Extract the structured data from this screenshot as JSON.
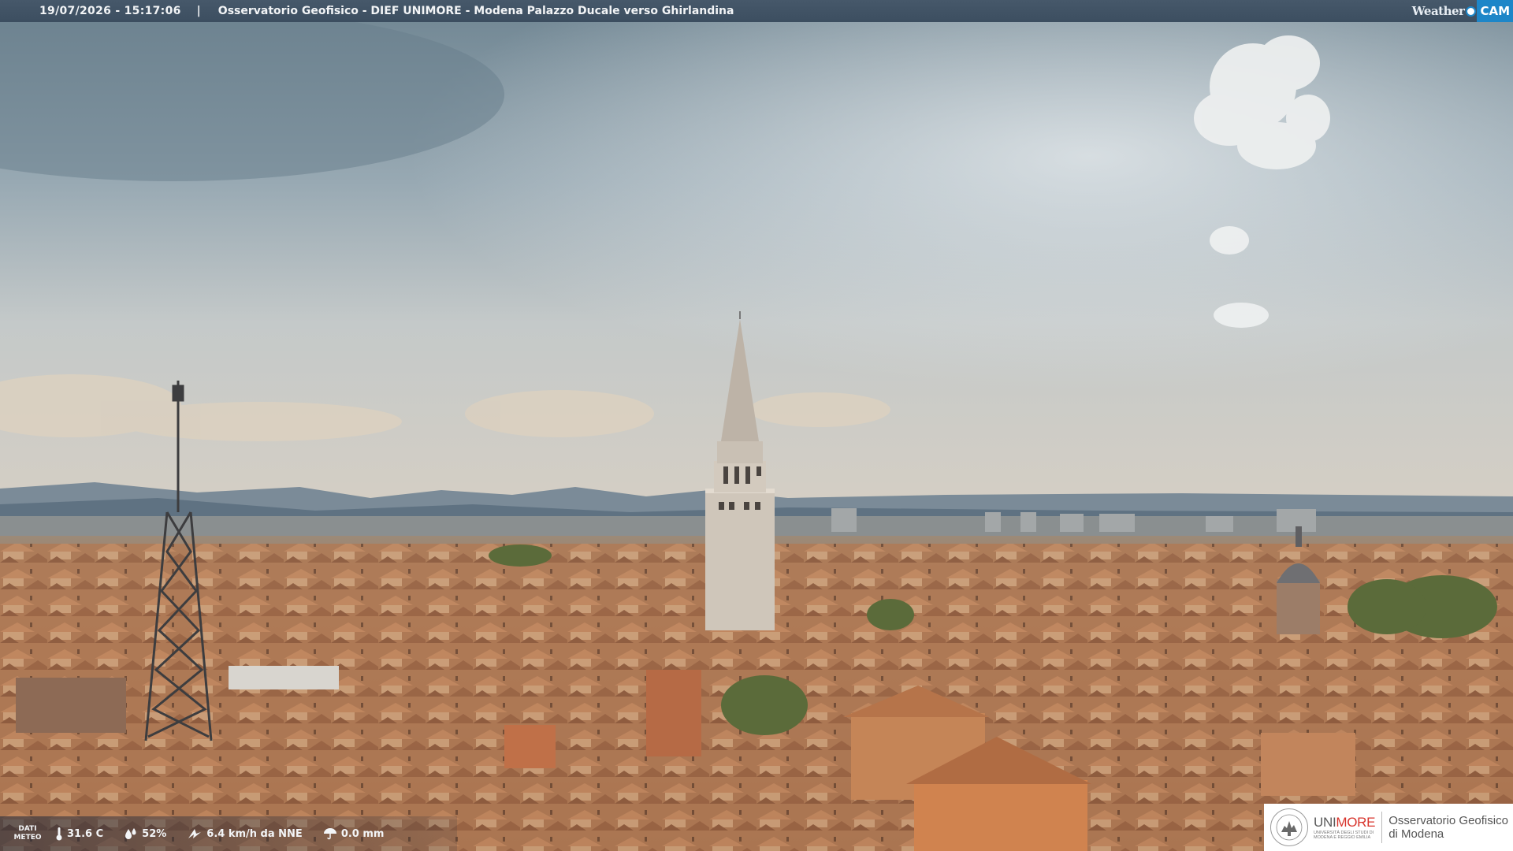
{
  "topbar": {
    "timestamp": "19/07/2026 - 15:17:06",
    "separator": "|",
    "caption": "Osservatorio Geofisico - DIEF UNIMORE - Modena Palazzo Ducale verso Ghirlandina"
  },
  "brand": {
    "weather": "Weather",
    "cam": "CAM"
  },
  "meteo": {
    "label_line1": "DATI",
    "label_line2": "METEO",
    "temperature": "31.6 C",
    "humidity": "52%",
    "wind": "6.4 km/h da NNE",
    "rain": "0.0 mm"
  },
  "badge": {
    "uni_prefix": "UNI",
    "uni_suffix": "MORE",
    "uni_sub_line1": "UNIVERSITÀ DEGLI STUDI DI",
    "uni_sub_line2": "MODENA E REGGIO EMILIA",
    "observatory_line1": "Osservatorio Geofisico",
    "observatory_line2": "di Modena"
  },
  "colors": {
    "banner": "#3c4e60",
    "cam_blue": "#1d86c8",
    "unimore_red": "#d8342c",
    "roof_terracotta": "#b8764e"
  }
}
